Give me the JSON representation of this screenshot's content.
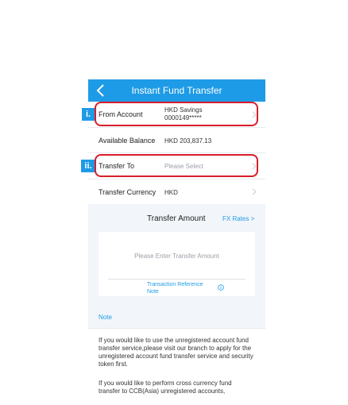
{
  "header": {
    "title": "Instant Fund Transfer"
  },
  "rows": {
    "from_account": {
      "label": "From Account",
      "value_line1": "HKD Savings",
      "value_line2": "0000149*****"
    },
    "available_balance": {
      "label": "Available Balance",
      "value": "HKD  203,837.13"
    },
    "transfer_to": {
      "label": "Transfer To",
      "placeholder": "Please Select"
    },
    "transfer_currency": {
      "label": "Transfer Currency",
      "value": "HKD"
    }
  },
  "amount": {
    "title": "Transfer Amount",
    "fx_link": "FX Rates >",
    "placeholder": "Please Enter Transfer Amount",
    "reference_note": "Transaction Reference Note"
  },
  "note": {
    "label": "Note",
    "paragraph1": "If you would like to use the unregistered account fund transfer service,please visit our branch to apply for the unregistered account fund transfer service and security token first.",
    "paragraph2": "If you would like to perform cross currency fund transfer to CCB(Asia) unregistered accounts,"
  },
  "markers": {
    "first": "i.",
    "second": "ii."
  },
  "colors": {
    "accent": "#1e9be6",
    "highlight": "#d81e2a"
  },
  "icons": {
    "back": "chevron-left-icon",
    "row_arrow": "chevron-right-icon",
    "info": "info-icon"
  }
}
